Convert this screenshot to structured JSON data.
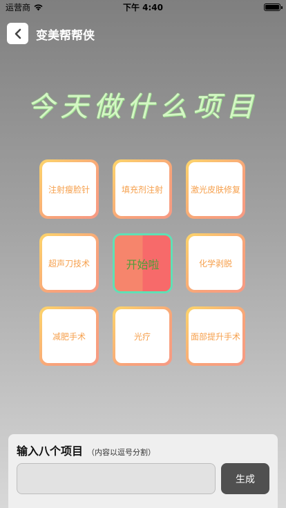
{
  "status": {
    "carrier": "运营商",
    "time": "下午 4:40"
  },
  "nav": {
    "title": "变美帮帮侠"
  },
  "headline": "今天做什么项目",
  "grid": {
    "items": [
      "注射瘦脸针",
      "填充剂注射",
      "激光皮肤修复",
      "超声刀技术",
      "化学剥脱",
      "减肥手术",
      "光疗",
      "面部提升手术"
    ],
    "start_label": "开始啦"
  },
  "panel": {
    "title": "输入八个项目",
    "hint": "（内容以逗号分割）",
    "input_value": "",
    "input_placeholder": "",
    "generate_label": "生成"
  }
}
